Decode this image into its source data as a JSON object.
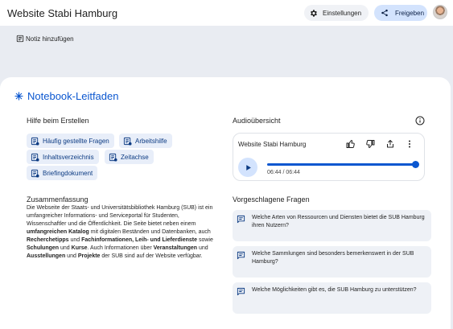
{
  "header": {
    "title": "Website Stabi Hamburg",
    "settings_label": "Einstellungen",
    "share_label": "Freigeben",
    "accent": "#0b57d0"
  },
  "toolbar": {
    "add_note_label": "Notiz hinzufügen"
  },
  "guide": {
    "title": "Notebook-Leitfaden",
    "create_help_label": "Hilfe beim Erstellen",
    "chips": [
      "Häufig gestellte Fragen",
      "Arbeitshilfe",
      "Inhaltsverzeichnis",
      "Zeitachse",
      "Briefingdokument"
    ],
    "summary": {
      "title": "Zusammenfassung",
      "segments": [
        {
          "t": "Die Webseite der Staats- und Universitätsbibliothek Hamburg (SUB) ist ein umfangreicher Informations- und Serviceportal für Studenten, Wissenschaftler und die Öffentlichkeit. Die Seite bietet neben einem ",
          "b": false
        },
        {
          "t": "umfangreichen Katalog",
          "b": true
        },
        {
          "t": " mit digitalen Beständen und Datenbanken, auch ",
          "b": false
        },
        {
          "t": "Recherchetipps",
          "b": true
        },
        {
          "t": " und ",
          "b": false
        },
        {
          "t": "Fachinformationen, Leih- und Lieferdienste",
          "b": true
        },
        {
          "t": " sowie ",
          "b": false
        },
        {
          "t": "Schulungen",
          "b": true
        },
        {
          "t": " und ",
          "b": false
        },
        {
          "t": "Kurse",
          "b": true
        },
        {
          "t": ". Auch Informationen über ",
          "b": false
        },
        {
          "t": "Veranstaltungen",
          "b": true
        },
        {
          "t": " und ",
          "b": false
        },
        {
          "t": "Ausstellungen",
          "b": true
        },
        {
          "t": " und ",
          "b": false
        },
        {
          "t": "Projekte",
          "b": true
        },
        {
          "t": " der SUB sind auf der Website verfügbar.",
          "b": false
        }
      ]
    }
  },
  "audio": {
    "section_label": "Audioübersicht",
    "title": "Website Stabi Hamburg",
    "time": "06:44 / 06:44",
    "progress": 1.0
  },
  "questions": {
    "section_label": "Vorgeschlagene Fragen",
    "items": [
      "Welche Arten von Ressourcen und Diensten bietet die SUB Hamburg ihren Nutzern?",
      "Welche Sammlungen sind besonders bemerkenswert in der SUB Hamburg?",
      "Welche Möglichkeiten gibt es, die SUB Hamburg zu unterstützen?"
    ]
  }
}
